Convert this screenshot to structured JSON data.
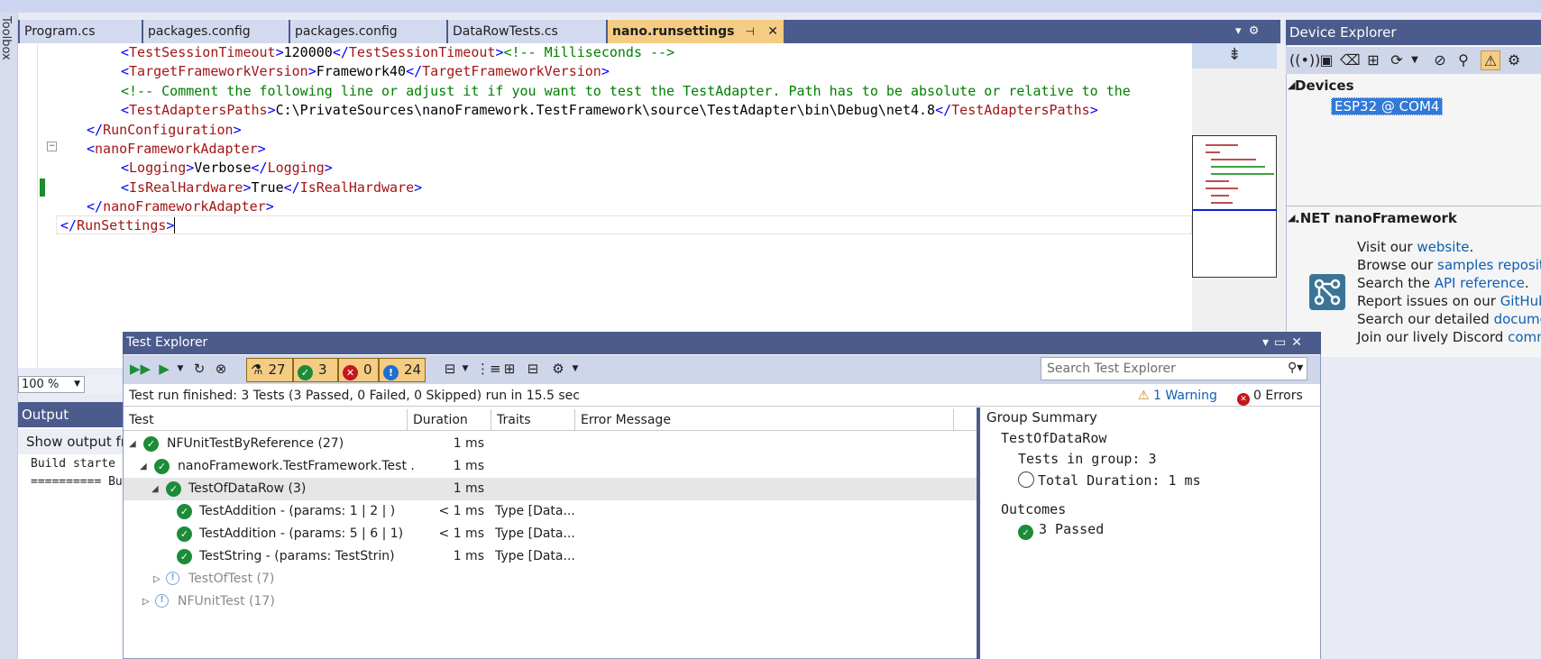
{
  "editor_tabs": [
    {
      "label": "Program.cs"
    },
    {
      "label": "packages.config"
    },
    {
      "label": "packages.config"
    },
    {
      "label": "DataRowTests.cs"
    },
    {
      "label": "nano.runsettings",
      "pin": "⊣",
      "close": "✕"
    }
  ],
  "toolbox": {
    "label": "Toolbox"
  },
  "code": {
    "l1": {
      "tag": "TestSessionTimeout",
      "value": "120000",
      "comment": "<!-- Milliseconds -->"
    },
    "l2": {
      "tag": "TargetFrameworkVersion",
      "value": "Framework40"
    },
    "l3": {
      "comment": "<!-- Comment the following line or adjust it if you want to test the TestAdapter. Path has to be absolute or relative to the"
    },
    "l4": {
      "tag": "TestAdaptersPaths",
      "value": "C:\\PrivateSources\\nanoFramework.TestFramework\\source\\TestAdapter\\bin\\Debug\\net4.8"
    },
    "l5": {
      "tag": "RunConfiguration"
    },
    "l6": {
      "tag": "nanoFrameworkAdapter"
    },
    "l7": {
      "tag": "Logging",
      "value": "Verbose"
    },
    "l8": {
      "tag": "IsRealHardware",
      "value": "True"
    },
    "l9": {
      "tag": "nanoFrameworkAdapter"
    },
    "l10": {
      "tag": "RunSettings"
    }
  },
  "zoom": {
    "value": "100 %"
  },
  "output": {
    "title": "Output",
    "show_label": "Show output fro",
    "lines": [
      "Build starte",
      "========== Bu"
    ]
  },
  "device_explorer": {
    "title": "Device Explorer",
    "devices_heading": "Devices",
    "device": "ESP32 @ COM4",
    "nf_heading": ".NET nanoFramework",
    "lines": [
      {
        "pre": "Visit our ",
        "link": "website",
        "post": "."
      },
      {
        "pre": "Browse our ",
        "link": "samples repository",
        "post": ""
      },
      {
        "pre": "Search the ",
        "link": "API reference",
        "post": "."
      },
      {
        "pre": "Report issues on our ",
        "link": "GitHub rep",
        "post": ""
      },
      {
        "pre": "Search our detailed ",
        "link": "documenta",
        "post": ""
      },
      {
        "pre": "Join our lively Discord ",
        "link": "commun",
        "post": ""
      }
    ]
  },
  "test_explorer": {
    "title": "Test Explorer",
    "counts": {
      "total": "27",
      "passed": "3",
      "failed": "0",
      "not_run": "24"
    },
    "search_placeholder": "Search Test Explorer",
    "status": "Test run finished: 3 Tests (3 Passed, 0 Failed, 0 Skipped) run in 15.5 sec",
    "warnings": "1 Warning",
    "errors": "0 Errors",
    "columns": {
      "test": "Test",
      "duration": "Duration",
      "traits": "Traits",
      "error": "Error Message"
    },
    "rows": [
      {
        "name": "NFUnitTestByReference",
        "count": "(27)",
        "duration": "1 ms",
        "traits": ""
      },
      {
        "name": "nanoFramework.TestFramework.Test .",
        "count": "",
        "duration": "1 ms",
        "traits": ""
      },
      {
        "name": "TestOfDataRow",
        "count": "(3)",
        "duration": "1 ms",
        "traits": ""
      },
      {
        "name": "TestAddition - (params: 1 | 2 | )",
        "count": "",
        "duration": "< 1 ms",
        "traits": "Type [Data..."
      },
      {
        "name": "TestAddition - (params: 5 | 6 | 1)",
        "count": "",
        "duration": "< 1 ms",
        "traits": "Type [Data..."
      },
      {
        "name": "TestString - (params: TestStrin)",
        "count": "",
        "duration": "1 ms",
        "traits": "Type [Data..."
      },
      {
        "name": "TestOfTest",
        "count": "(7)",
        "duration": "",
        "traits": ""
      },
      {
        "name": "NFUnitTest",
        "count": "(17)",
        "duration": "",
        "traits": ""
      }
    ],
    "group_summary": {
      "heading": "Group Summary",
      "group": "TestOfDataRow",
      "tests_in_group_label": "Tests in group:",
      "tests_in_group_value": "3",
      "total_duration_label": "Total Duration:",
      "total_duration_value": "1 ms",
      "outcomes_heading": "Outcomes",
      "passed": "3 Passed"
    }
  },
  "colors": {
    "title_bar": "#4b5b8c",
    "accent_tab": "#f5cc84",
    "pass": "#1c8c39",
    "fail": "#c4161c",
    "info": "#1e6fd0"
  }
}
